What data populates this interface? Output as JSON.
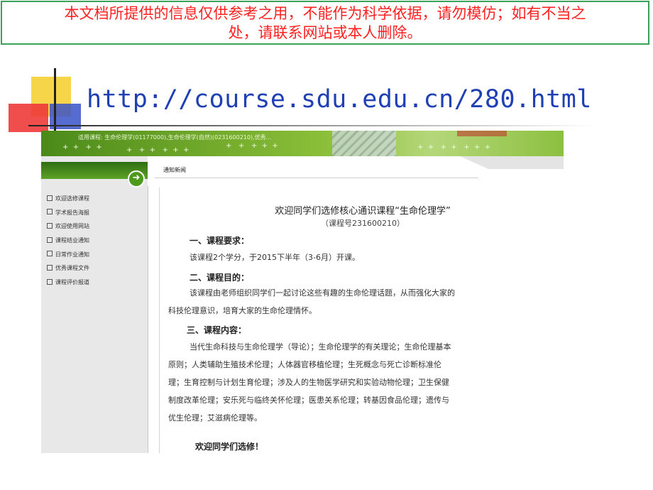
{
  "disclaimer": {
    "line1": "本文档所提供的信息仅供参考之用，不能作为科学依据，请勿模仿；如有不当之",
    "line2": "处，请联系网站或本人删除。"
  },
  "slide": {
    "url": "http://course.sdu.edu.cn/280.html"
  },
  "site": {
    "banner_courses": "适用课程: 生命伦理学(01177000),生命伦理学(自然)(0231600210),优秀...",
    "breadcrumb": "通知新闻",
    "go_icon": "arrow-right-icon",
    "menu": [
      "欢迎选修课程",
      "学术报告海报",
      "欢迎使用网站",
      "课程结业通知",
      "日常作业通知",
      "优秀课程文件",
      "课程评价报道"
    ]
  },
  "article": {
    "title": "欢迎同学们选修核心通识课程“生命伦理学”",
    "subtitle": "（课程号231600210）",
    "s1_heading": "一、课程要求：",
    "s1_text": "该课程2个学分，于2015下半年（3-6月）开课。",
    "s2_heading": "二、课程目的：",
    "s2_line1": "该课程由老师组织同学们一起讨论这些有趣的生命伦理话题，从而强化大家的",
    "s2_line2": "科技伦理意识，培育大家的生命伦理情怀。",
    "s3_heading": "三、课程内容：",
    "s3_lines": [
      "当代生命科技与生命伦理学（导论）；生命伦理学的有关理论；生命伦理基本",
      "原则；人类辅助生殖技术伦理；人体器官移植伦理；生死概念与死亡诊断标准伦",
      "理；生育控制与计划生育伦理；涉及人的生物医学研究和实验动物伦理；卫生保健",
      "制度改革伦理；安乐死与临终关怀伦理；医患关系伦理；转基因食品伦理；遗传与",
      "优生伦理；艾滋病伦理等。"
    ],
    "closing": "欢迎同学们选修！"
  }
}
